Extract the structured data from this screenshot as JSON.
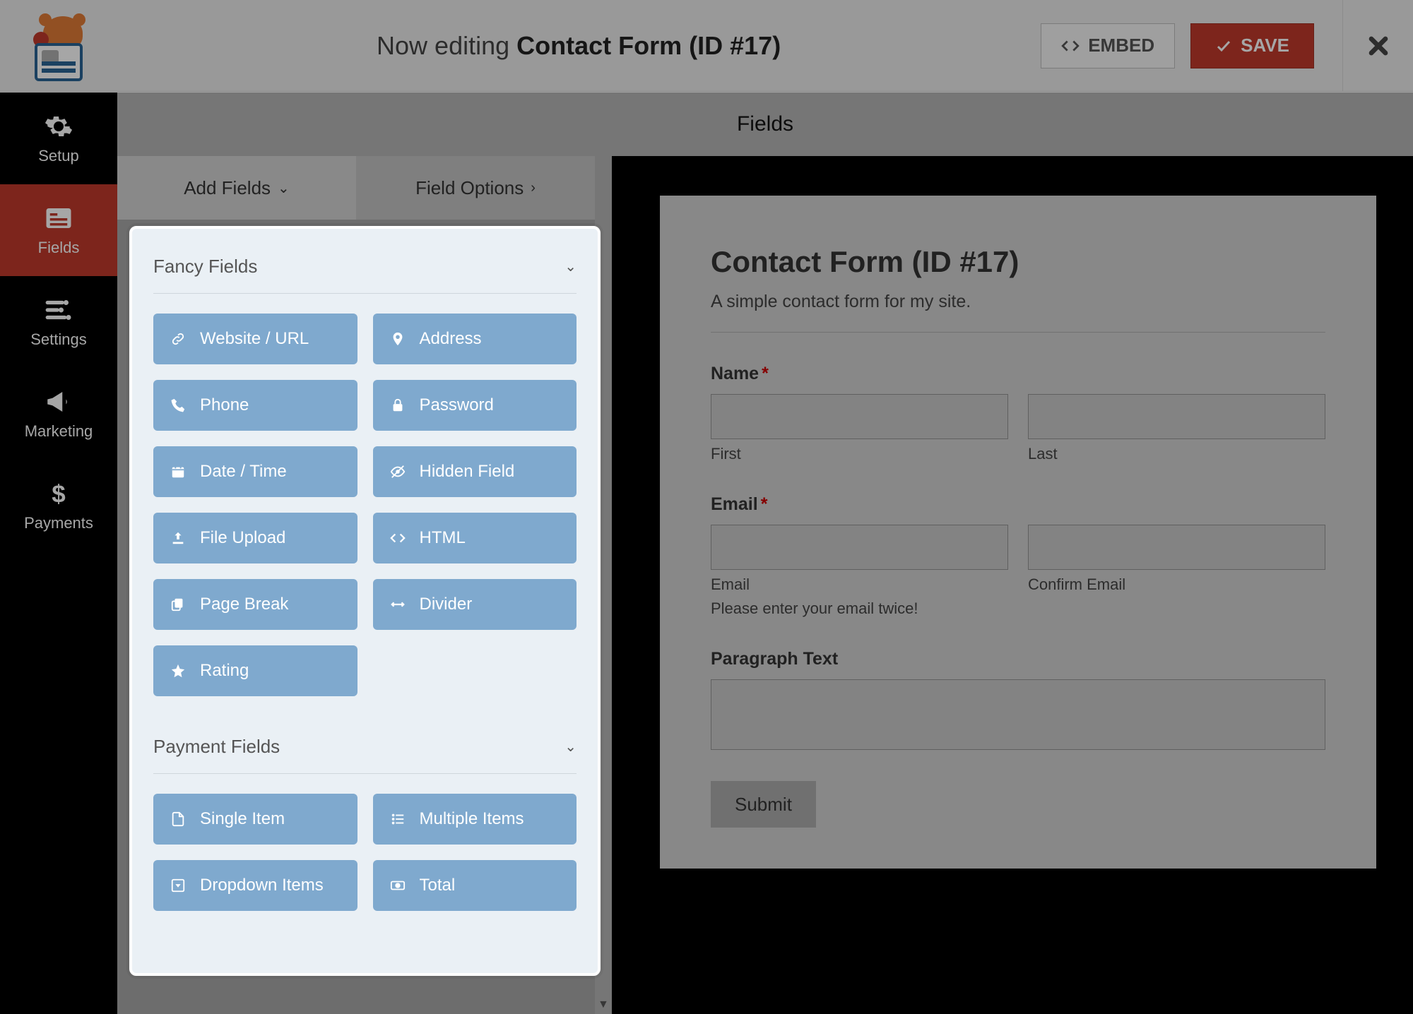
{
  "topbar": {
    "editing_prefix": "Now editing ",
    "editing_title": "Contact Form (ID #17)",
    "embed_label": "EMBED",
    "save_label": "SAVE"
  },
  "sidebar": {
    "items": [
      {
        "label": "Setup"
      },
      {
        "label": "Fields"
      },
      {
        "label": "Settings"
      },
      {
        "label": "Marketing"
      },
      {
        "label": "Payments"
      }
    ]
  },
  "sub_header": {
    "title": "Fields"
  },
  "panel_tabs": {
    "add_fields": "Add Fields",
    "field_options": "Field Options"
  },
  "sections": {
    "fancy": {
      "title": "Fancy Fields",
      "items": [
        {
          "label": "Website / URL",
          "icon": "link"
        },
        {
          "label": "Address",
          "icon": "pin"
        },
        {
          "label": "Phone",
          "icon": "phone"
        },
        {
          "label": "Password",
          "icon": "lock"
        },
        {
          "label": "Date / Time",
          "icon": "calendar"
        },
        {
          "label": "Hidden Field",
          "icon": "eyeoff"
        },
        {
          "label": "File Upload",
          "icon": "upload"
        },
        {
          "label": "HTML",
          "icon": "code"
        },
        {
          "label": "Page Break",
          "icon": "copy"
        },
        {
          "label": "Divider",
          "icon": "arrows"
        },
        {
          "label": "Rating",
          "icon": "star"
        }
      ]
    },
    "payment": {
      "title": "Payment Fields",
      "items": [
        {
          "label": "Single Item",
          "icon": "file"
        },
        {
          "label": "Multiple Items",
          "icon": "list"
        },
        {
          "label": "Dropdown Items",
          "icon": "caretbox"
        },
        {
          "label": "Total",
          "icon": "money"
        }
      ]
    }
  },
  "preview": {
    "title": "Contact Form (ID #17)",
    "description": "A simple contact form for my site.",
    "name_label": "Name",
    "first_sub": "First",
    "last_sub": "Last",
    "email_label": "Email",
    "email_sub": "Email",
    "confirm_sub": "Confirm Email",
    "email_hint": "Please enter your email twice!",
    "paragraph_label": "Paragraph Text",
    "submit_label": "Submit",
    "required_mark": "*"
  }
}
